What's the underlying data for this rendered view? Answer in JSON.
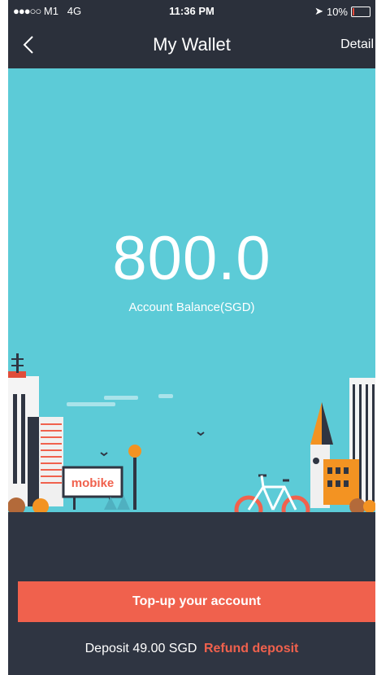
{
  "status_bar": {
    "carrier": "M1",
    "network": "4G",
    "time": "11:36 PM",
    "battery": "10%",
    "battery_level": 0.1,
    "signal_dots": "●●●○○"
  },
  "nav": {
    "title": "My Wallet",
    "detail_label": "Detail",
    "back_icon": "chevron-left-icon"
  },
  "balance": {
    "amount": "800.0",
    "label": "Account Balance(SGD)"
  },
  "scene": {
    "sign_text": "mobike"
  },
  "actions": {
    "topup_label": "Top-up your account",
    "deposit_text": "Deposit 49.00  SGD",
    "refund_label": "Refund deposit"
  },
  "colors": {
    "accent": "#f0614d",
    "sky": "#5ccbd7",
    "dark": "#2f3542"
  }
}
